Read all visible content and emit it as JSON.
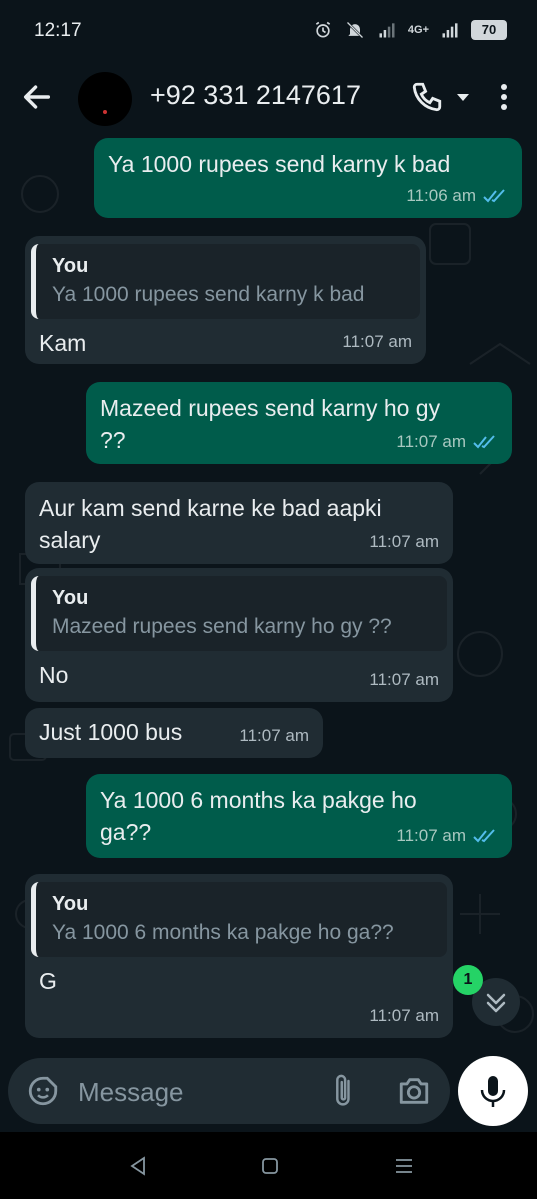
{
  "status_bar": {
    "time": "12:17",
    "network_label": "4G+",
    "battery": "70"
  },
  "header": {
    "contact": "+92 331 2147617",
    "icons": [
      "back-arrow-icon",
      "phone-icon",
      "dropdown-caret-icon",
      "more-vert-icon"
    ]
  },
  "messages": [
    {
      "dir": "out",
      "text": "Ya 1000 rupees send karny k bad",
      "time": "11:06 am",
      "read": true
    },
    {
      "dir": "in",
      "quote_author": "You",
      "quote_text": "Ya 1000 rupees send karny k bad",
      "text": "Kam",
      "time": "11:07 am"
    },
    {
      "dir": "out",
      "text": "Mazeed rupees send karny ho gy ??",
      "time": "11:07 am",
      "read": true
    },
    {
      "dir": "in",
      "text": "Aur kam send karne ke bad aapki salary",
      "time": "11:07 am"
    },
    {
      "dir": "in",
      "quote_author": "You",
      "quote_text": "Mazeed rupees send karny ho gy ??",
      "text": "No",
      "time": "11:07 am"
    },
    {
      "dir": "in",
      "text": "Just 1000 bus",
      "time": "11:07 am"
    },
    {
      "dir": "out",
      "text": "Ya 1000 6 months ka pakge ho ga??",
      "time": "11:07 am",
      "read": true
    },
    {
      "dir": "in",
      "quote_author": "You",
      "quote_text": "Ya 1000 6 months ka pakge ho ga??",
      "text": "G",
      "time": "11:07 am"
    }
  ],
  "unread_badge": "1",
  "composer": {
    "placeholder": "Message"
  },
  "colors": {
    "background": "#0b141a",
    "outgoing_bubble": "#005c4b",
    "incoming_bubble": "#202c33",
    "read_ticks": "#53bdeb",
    "badge": "#25d366"
  }
}
